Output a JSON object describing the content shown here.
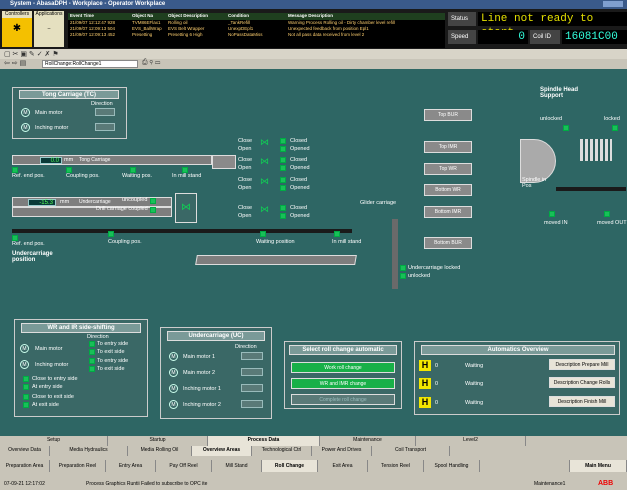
{
  "window_title": "System - AbasaDPH - Workplace - Operator Workplace",
  "topbar": {
    "controllers_label": "Controllers",
    "applications_label": "Applications",
    "alarm_headers": [
      "Event Time",
      "Object Na",
      "Object Description",
      "Condition",
      "Message Description"
    ],
    "alarm_rows": [
      [
        "21/09/07 12:12:47 928",
        "TVM86EFlax1",
        "Rolling oil",
        "_TankRefill",
        "Warning Process Rolling oil - Dirty chamber level refill"
      ],
      [
        "21/09/07 12:09:13 504",
        "EVS_BallWrap",
        "EVS Belt Wrapper",
        "UnexpDEpl1",
        "Unexpected feedback from position Epl1"
      ],
      [
        "21/09/07 12:09:13 452",
        "Presetting",
        "Presetting 6 High",
        "NoPassDataMiss",
        "Not all pass data received from level 2"
      ]
    ],
    "status_label": "Status",
    "status_text": "Line not ready to start",
    "speed_label": "Speed",
    "speed_value": "0",
    "coil_label": "Coil ID",
    "coil_value": "16081C00"
  },
  "toolbar": {
    "dropdown": "RollChange:RollChange1"
  },
  "tong": {
    "title": "Tong Carriage (TC)",
    "direction": "Direction",
    "main_motor": "Main motor",
    "inching_motor": "Inching motor",
    "carriage_label": "Tong Carriage",
    "value1": "0.0",
    "unit": "mm",
    "ref_end": "Ref. end pos.",
    "coupling": "Coupling pos.",
    "waiting": "Waiting pos.",
    "in_mill": "In mill stand"
  },
  "undercarriage": {
    "label": "Undercarriage",
    "value": "-15.3",
    "unit": "mm",
    "uncoupled": "uncoupled",
    "drill_coupled": "Drill carriage coupled",
    "ref_end": "Ref. end pos.",
    "coupling": "Coupling pos.",
    "waiting": "Waiting position",
    "in_mill": "In mill stand",
    "position_title": "Undercarriage\nposition",
    "gliders": "Glider carriage",
    "locked": "Undercarriage locked",
    "unlocked": "unlocked"
  },
  "closes": [
    {
      "close": "Close",
      "open": "Open",
      "closed": "Closed",
      "opened": "Opened"
    },
    {
      "close": "Close",
      "open": "Open",
      "closed": "Closed",
      "opened": "Opened"
    },
    {
      "close": "Close",
      "open": "Open",
      "closed": "Closed",
      "opened": "Opened"
    },
    {
      "close": "Close",
      "open": "Open",
      "closed": "Closed",
      "opened": "Opened"
    }
  ],
  "rolls": [
    "Top BUR",
    "Top IMR",
    "Top WR",
    "Bottom WR",
    "Bottom IMR",
    "Bottom BUR"
  ],
  "spindle": {
    "title": "Spindle Head\nSupport",
    "unlocked": "unlocked",
    "locked": "locked",
    "spindle_in_pos": "Spindle in\nPos",
    "moved_in": "moved IN",
    "moved_out": "moved OUT"
  },
  "wr_ir": {
    "title": "WR and IR side-shifting",
    "direction": "Direction",
    "main_motor": "Main motor",
    "inching_motor": "Inching motor",
    "to_entry": "To entry side",
    "to_exit": "To exit side",
    "close_entry": "Close to entry side",
    "at_entry": "At entry side",
    "close_exit": "Close to exit side",
    "at_exit": "At exit side"
  },
  "uc": {
    "title": "Undercarriage (UC)",
    "direction": "Direction",
    "main1": "Main motor 1",
    "main2": "Main motor 2",
    "inch1": "Inching motor 1",
    "inch2": "Inching motor 2"
  },
  "select": {
    "title": "Select roll change automatic",
    "btn1": "Work roll change",
    "btn2": "WR and IMR change",
    "btn3": "Complete roll change"
  },
  "auto": {
    "title": "Automatics Overview",
    "rows": [
      {
        "h": "H",
        "num": "0",
        "state": "Waiting",
        "btn": "Description Prepare Mill"
      },
      {
        "h": "H",
        "num": "0",
        "state": "Waiting",
        "btn": "Description Change Rolls"
      },
      {
        "h": "H",
        "num": "0",
        "state": "Waiting",
        "btn": "Description Finish Mill"
      }
    ]
  },
  "tabs_row1": [
    "Setup",
    "Startup",
    "Process Data",
    "Maintenance",
    "Level2"
  ],
  "tabs_row2": [
    "Overview Data",
    "Media Hydraulics",
    "Media Rolling Oil",
    "Overview Areas",
    "Technological Ctrl",
    "Power And Drives",
    "Coil Transport"
  ],
  "tabs_row3": [
    "Preparation Area",
    "Preparation Reel",
    "Entry Area",
    "Pay Off Reel",
    "Mill Stand",
    "Roll Change",
    "Exit Area",
    "Tension Reel",
    "Spool Handling",
    "",
    "Main Menu"
  ],
  "statusbar": {
    "time": "07-09-21 12:17:02",
    "message": "Process Graphics Runtii Failed to subscribe to OPC ite",
    "user": "Maintenance1",
    "brand": "ABB"
  }
}
